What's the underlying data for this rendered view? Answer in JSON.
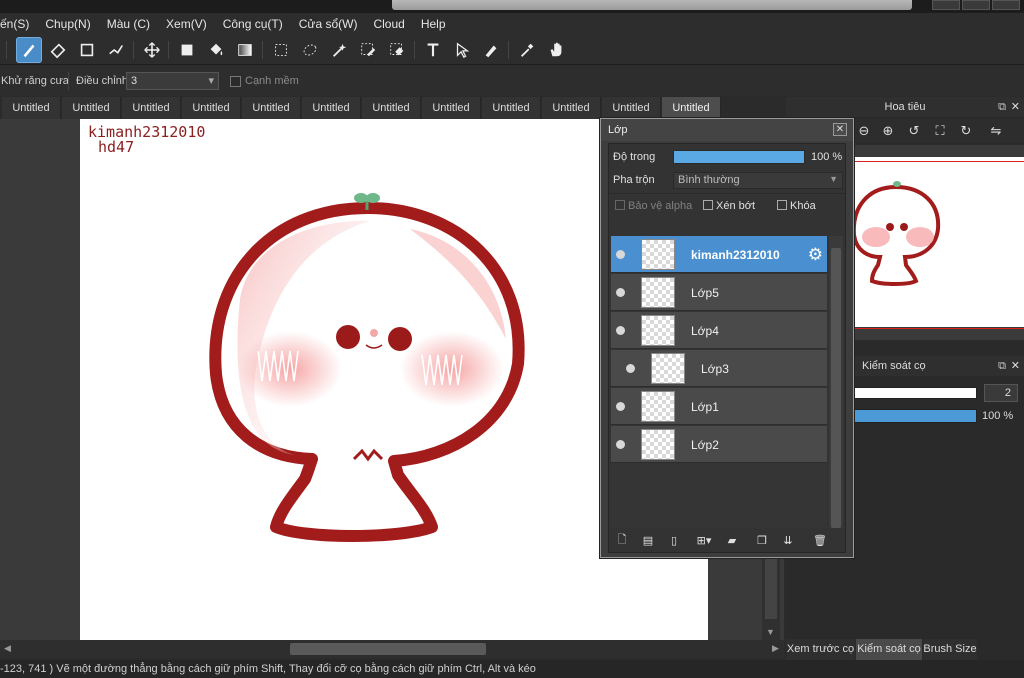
{
  "menu": [
    "ến(S)",
    "Chụp(N)",
    "Màu (C)",
    "Xem(V)",
    "Công cụ(T)",
    "Cửa sổ(W)",
    "Cloud",
    "Help"
  ],
  "options_bar": {
    "antialias_label": "Khử răng cưa",
    "adjust_label": "Điều chỉnh",
    "adjust_value": "3",
    "smooth_label": "Cạnh mềm"
  },
  "document_tabs": [
    "Untitled",
    "Untitled",
    "Untitled",
    "Untitled",
    "Untitled",
    "Untitled",
    "Untitled",
    "Untitled",
    "Untitled",
    "Untitled",
    "Untitled",
    "Untitled"
  ],
  "active_tab_index": 11,
  "canvas": {
    "signature_line1": "kimanh2312010",
    "signature_line2": "hd47"
  },
  "layer_panel": {
    "title": "Lớp",
    "opacity_label": "Độ trong",
    "opacity_value": "100 %",
    "opacity_fraction": 1.0,
    "blend_label": "Pha trộn",
    "blend_value": "Bình thường",
    "protect_alpha": "Bảo vệ alpha",
    "clipping": "Xén bớt",
    "lock": "Khóa",
    "layers": [
      {
        "name": "kimanh2312010",
        "selected": true
      },
      {
        "name": "Lớp5",
        "selected": false
      },
      {
        "name": "Lớp4",
        "selected": false
      },
      {
        "name": "Lớp3",
        "selected": false
      },
      {
        "name": "Lớp1",
        "selected": false
      },
      {
        "name": "Lớp2",
        "selected": false
      }
    ]
  },
  "navigator": {
    "title": "Hoa tiêu"
  },
  "brush_control": {
    "title": "Kiểm soát cọ",
    "size_value": "2",
    "opacity_value": "100 %",
    "opacity_fraction": 1.0
  },
  "bottom_tabs": [
    "Xem trước cọ",
    "Kiểm soát cọ",
    "Brush Size"
  ],
  "status": "-123, 741 )   Vẽ một đường thẳng bằng cách giữ phím Shift, Thay đổi cỡ cọ bằng cách giữ phím Ctrl, Alt và kéo",
  "colors": {
    "accent": "#4a90d0",
    "brush_red": "#a31c1c"
  }
}
